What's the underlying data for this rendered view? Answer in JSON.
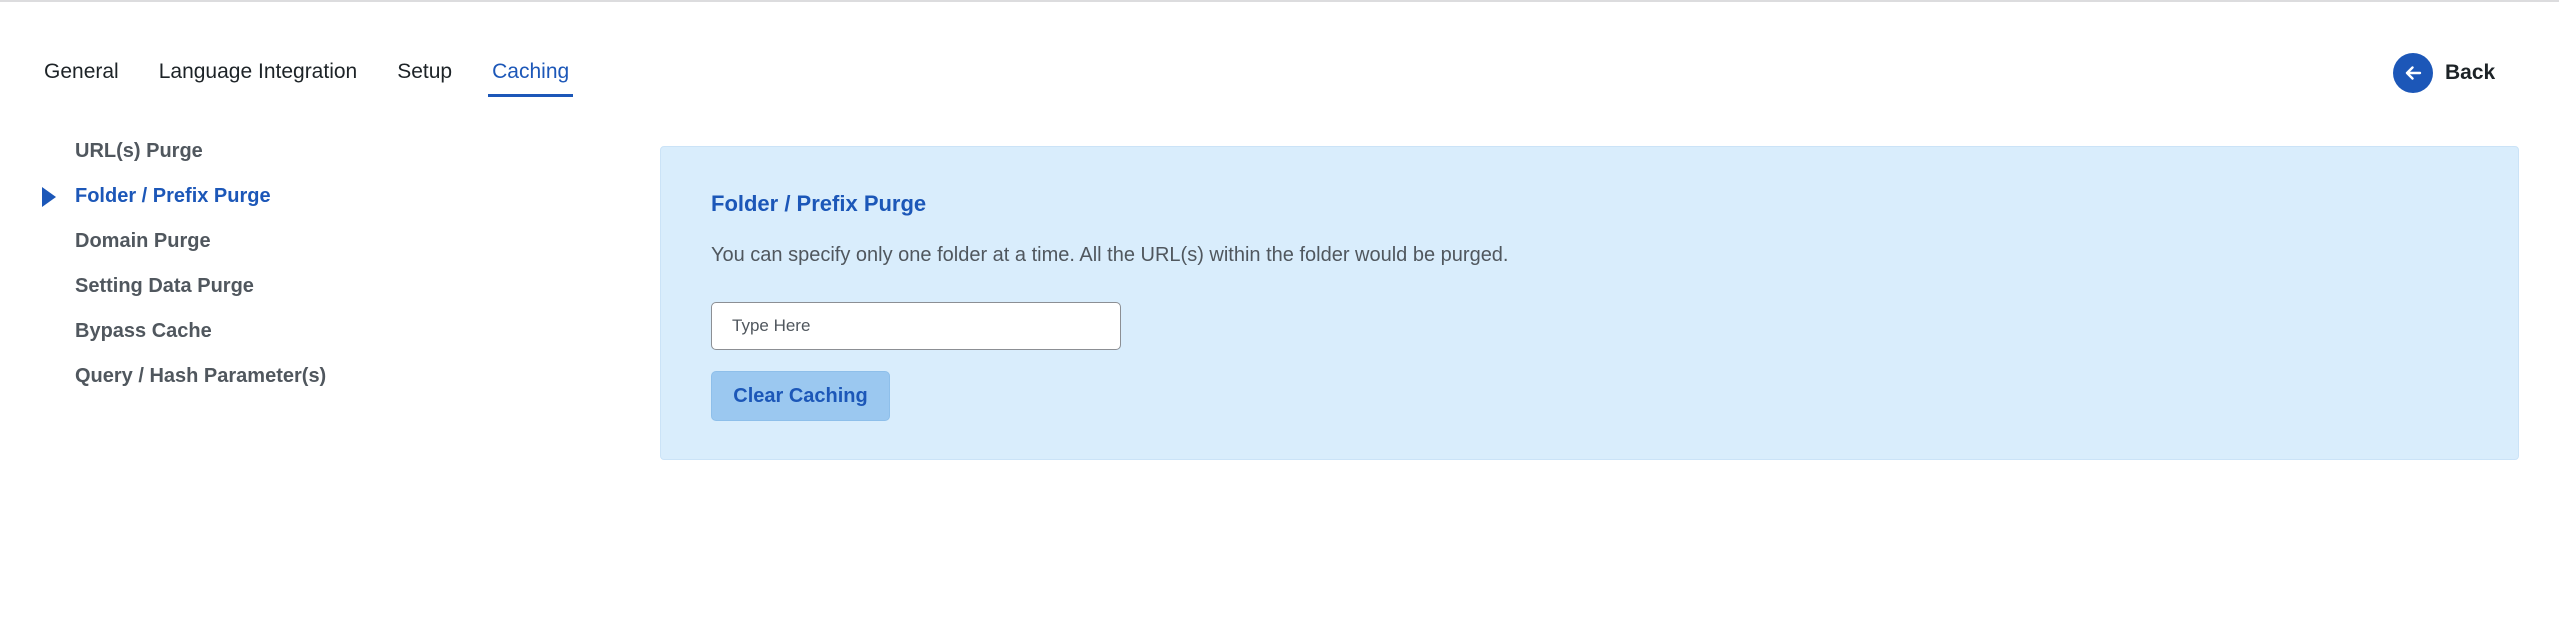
{
  "tabs": [
    {
      "label": "General",
      "active": false
    },
    {
      "label": "Language Integration",
      "active": false
    },
    {
      "label": "Setup",
      "active": false
    },
    {
      "label": "Caching",
      "active": true
    }
  ],
  "back": {
    "label": "Back",
    "icon": "arrow-left-icon"
  },
  "sidebar": {
    "items": [
      {
        "label": "URL(s) Purge",
        "active": false
      },
      {
        "label": "Folder / Prefix Purge",
        "active": true
      },
      {
        "label": "Domain Purge",
        "active": false
      },
      {
        "label": "Setting Data Purge",
        "active": false
      },
      {
        "label": "Bypass Cache",
        "active": false
      },
      {
        "label": "Query / Hash Parameter(s)",
        "active": false
      }
    ]
  },
  "panel": {
    "title": "Folder / Prefix Purge",
    "description": "You can specify only one folder at a time. All the URL(s) within the folder would be purged.",
    "input": {
      "value": "",
      "placeholder": "Type Here"
    },
    "button_label": "Clear Caching"
  },
  "colors": {
    "accent": "#1c57b8",
    "panel_background": "#d9edfc",
    "button_background": "#9bc8f0",
    "muted_text": "#50575e"
  }
}
